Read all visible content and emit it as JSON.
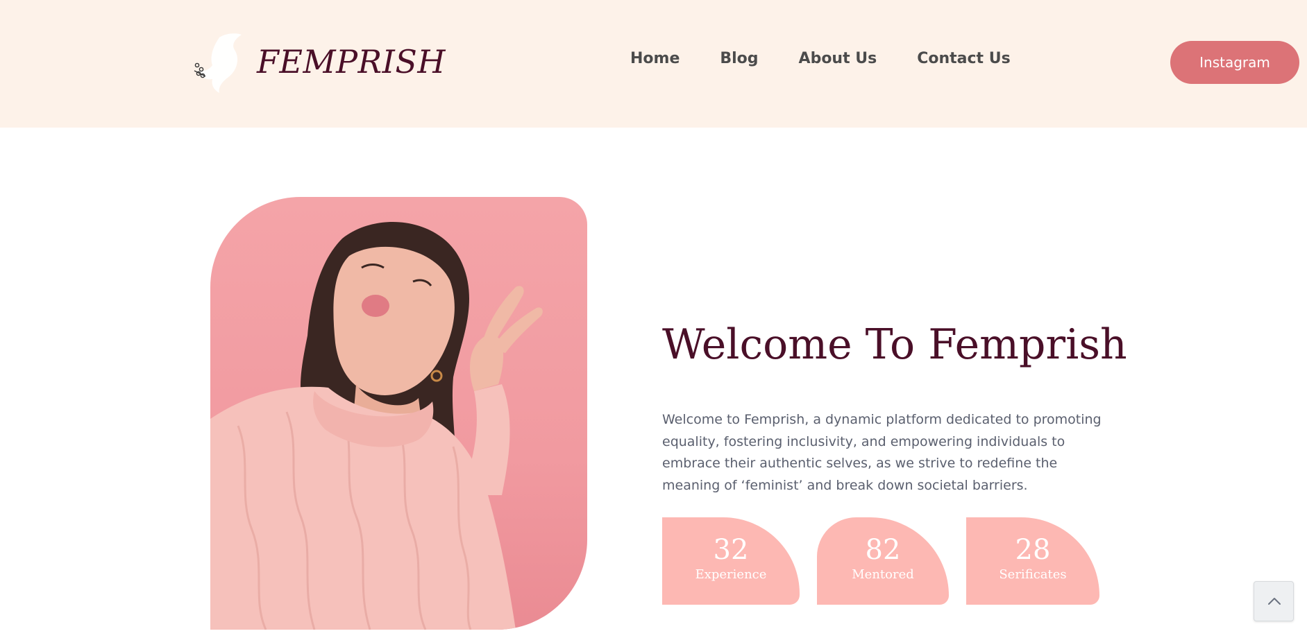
{
  "header": {
    "logo_text": "FEMPRISH",
    "nav": [
      {
        "label": "Home"
      },
      {
        "label": "Blog"
      },
      {
        "label": "About Us"
      },
      {
        "label": "Contact Us"
      }
    ],
    "cta_label": "Instagram"
  },
  "hero": {
    "image_icon": "woman-photo",
    "title": "Welcome To Femprish",
    "description": "Welcome to Femprish, a dynamic platform dedicated to promoting equality, fostering inclusivity, and empowering individuals to embrace their authentic selves, as we strive to redefine the meaning of ‘feminist’ and break down societal barriers.",
    "stats": [
      {
        "value": "32",
        "label": "Experience"
      },
      {
        "value": "82",
        "label": "Mentored"
      },
      {
        "value": "28",
        "label": "Serificates"
      }
    ]
  },
  "scroll_top_icon": "chevron-up-icon",
  "colors": {
    "header_bg": "#fdf2e9",
    "brand": "#4a0f28",
    "cta": "#dc7377",
    "stat_bg": "#fdb8b3",
    "body_text": "#5a5f6e"
  }
}
